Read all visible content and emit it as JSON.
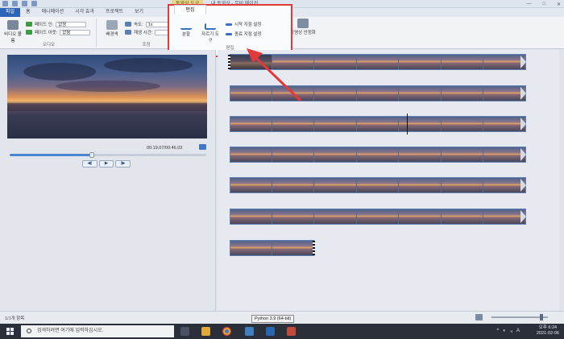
{
  "window": {
    "context_tab_title": "동영상 도구",
    "app_title": "내 동영상 - 무비 메이커",
    "controls": [
      "—",
      "□",
      "✕"
    ]
  },
  "tabs": [
    {
      "label": "파일"
    },
    {
      "label": "홈"
    },
    {
      "label": "애니메이션"
    },
    {
      "label": "시각 효과"
    },
    {
      "label": "프로젝트"
    },
    {
      "label": "보기"
    },
    {
      "label": "편집"
    }
  ],
  "ribbon": {
    "audio_group": {
      "video_volume": "비디오 볼륨",
      "fade_in_label": "페이드 인:",
      "fade_in_value": "없음",
      "fade_out_label": "페이드 아웃:",
      "fade_out_value": "없음",
      "label": "오디오"
    },
    "adjust_group": {
      "background": "배경색",
      "speed_label": "속도:",
      "speed_value": "1x",
      "duration_label": "재생 시간:",
      "label": "조정"
    },
    "editing_group": {
      "split": "분할",
      "trim_tool": "자르기 도구",
      "set_start": "시작 지점 설정",
      "set_end": "종료 지점 설정",
      "label": "편집"
    },
    "stabilization": "동영상 안정화"
  },
  "player": {
    "timecode": "00:19.07/00:46.03",
    "progress": 0.42,
    "buttons": [
      "◀|",
      "▶",
      "|▶"
    ]
  },
  "storyboard": {
    "rows": [
      {
        "frames": 7,
        "selected_prefix": 1
      },
      {
        "frames": 7
      },
      {
        "frames": 7,
        "cursor": true
      },
      {
        "frames": 7
      },
      {
        "frames": 7
      },
      {
        "frames": 7
      },
      {
        "frames": 2,
        "end": true
      }
    ]
  },
  "status": {
    "items": "1/1개 항목"
  },
  "taskbar": {
    "search_placeholder": "검색하려면 여기에 입력하십시오.",
    "tooltip": "Python 3.9 (64-bit)",
    "time": "오후 6:24",
    "date": "2021-02-06"
  },
  "colors": {
    "highlight": "#e13a3a",
    "accent": "#2e64b8",
    "context_tab": "#e8d68a"
  }
}
